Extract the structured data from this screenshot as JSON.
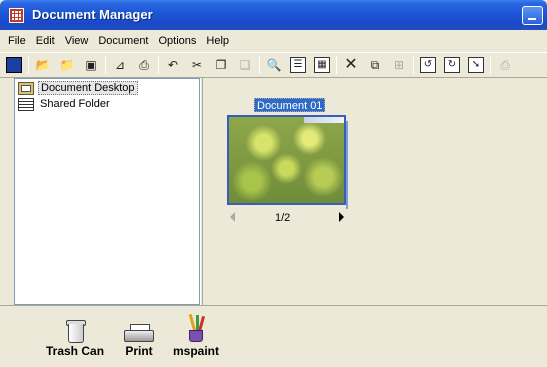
{
  "window": {
    "title": "Document Manager",
    "icon": "app-grid-icon",
    "accent_color": "#1d55d6"
  },
  "menu": [
    "File",
    "Edit",
    "View",
    "Document",
    "Options",
    "Help"
  ],
  "toolbar": {
    "icons": [
      "properties-icon",
      "new-folder-icon",
      "open-icon",
      "save-icon",
      "scan-icon",
      "print-icon",
      "undo-icon",
      "cut-icon",
      "copy-icon",
      "paste-icon",
      "zoom-icon",
      "view-list-icon",
      "view-thumbnails-icon",
      "delete-icon",
      "duplicate-icon",
      "merge-icon",
      "rotate-left-icon",
      "rotate-right-icon",
      "export-icon",
      "fax-icon"
    ]
  },
  "tree": {
    "items": [
      {
        "label": "Document Desktop",
        "icon": "desktop-icon",
        "selected": true
      },
      {
        "label": "Shared Folder",
        "icon": "shared-folder-icon",
        "selected": false
      }
    ]
  },
  "document": {
    "title": "Document 01",
    "page_indicator": "1/2"
  },
  "bottom": {
    "items": [
      {
        "label": "Trash Can",
        "icon": "trash-icon"
      },
      {
        "label": "Print",
        "icon": "printer-icon"
      },
      {
        "label": "mspaint",
        "icon": "paint-icon"
      }
    ]
  }
}
